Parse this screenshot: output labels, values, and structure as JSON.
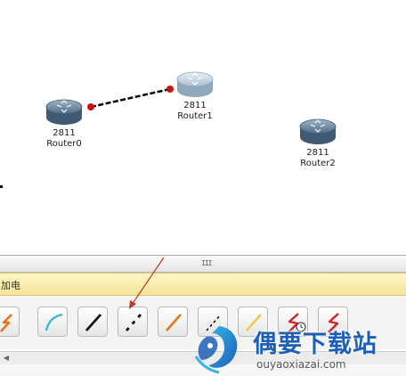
{
  "workspace": {
    "routers": [
      {
        "model": "2811",
        "name": "Router0"
      },
      {
        "model": "2811",
        "name": "Router1"
      },
      {
        "model": "2811",
        "name": "Router2"
      }
    ],
    "link_color": "#000000",
    "link_endpoint_color": "#cc1111"
  },
  "device_panel": {
    "category_title": "加电",
    "connection_icons": [
      "automatic-connection-icon",
      "console-cable-icon",
      "copper-straight-through-icon",
      "copper-cross-over-icon",
      "fiber-icon",
      "phone-cable-icon",
      "coaxial-cable-icon",
      "serial-dce-icon",
      "serial-dte-icon"
    ],
    "annotation_arrow_color": "#c0392b"
  },
  "watermark": {
    "title": "偶要下载站",
    "url": "ouyaoxiazai.com",
    "accent": "#1d5fb8"
  }
}
